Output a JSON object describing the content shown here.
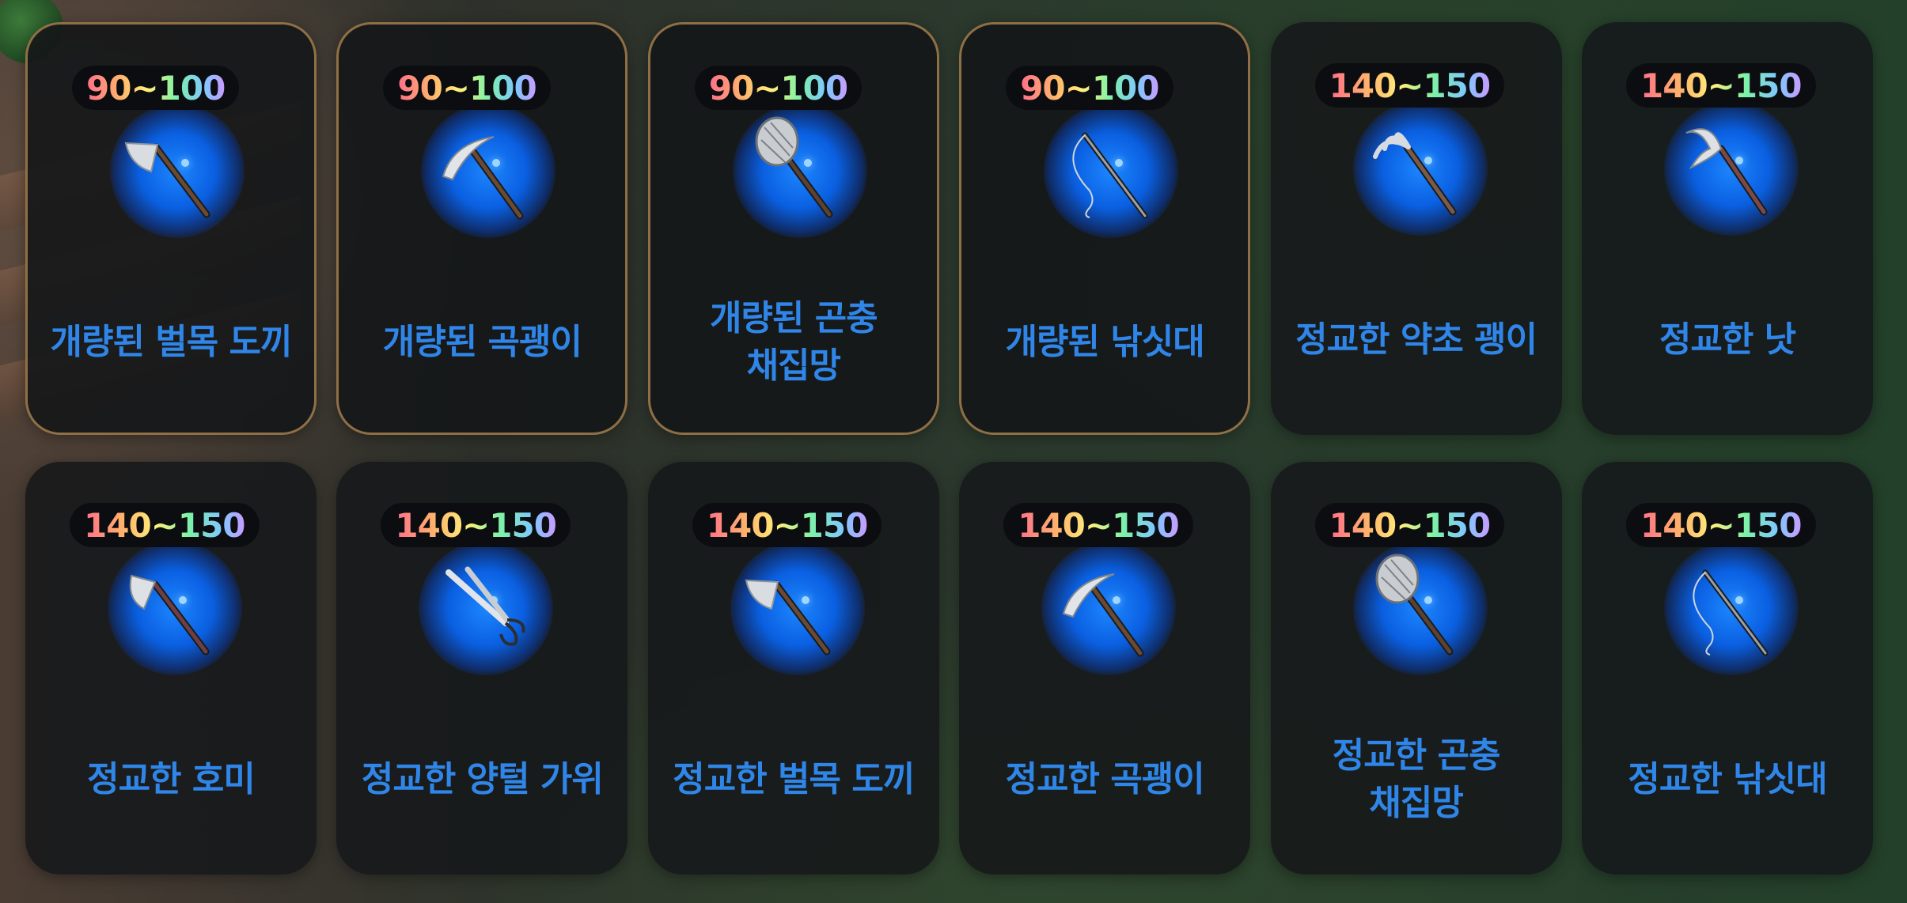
{
  "items": [
    {
      "level": "90~100",
      "name": "개량된 벌목 도끼",
      "tool_icon": "axe-icon",
      "tier": "improved"
    },
    {
      "level": "90~100",
      "name": "개량된 곡괭이",
      "tool_icon": "pickaxe-icon",
      "tier": "improved"
    },
    {
      "level": "90~100",
      "name": "개량된 곤충\n채집망",
      "tool_icon": "bug-net-icon",
      "tier": "improved"
    },
    {
      "level": "90~100",
      "name": "개량된 낚싯대",
      "tool_icon": "fishing-rod-icon",
      "tier": "improved"
    },
    {
      "level": "140~150",
      "name": "정교한 약초 괭이",
      "tool_icon": "herb-rake-icon",
      "tier": "elaborate"
    },
    {
      "level": "140~150",
      "name": "정교한 낫",
      "tool_icon": "sickle-icon",
      "tier": "elaborate"
    },
    {
      "level": "140~150",
      "name": "정교한 호미",
      "tool_icon": "hoe-icon",
      "tier": "elaborate"
    },
    {
      "level": "140~150",
      "name": "정교한 양털 가위",
      "tool_icon": "shears-icon",
      "tier": "elaborate"
    },
    {
      "level": "140~150",
      "name": "정교한 벌목 도끼",
      "tool_icon": "axe-icon",
      "tier": "elaborate"
    },
    {
      "level": "140~150",
      "name": "정교한 곡괭이",
      "tool_icon": "pickaxe-icon",
      "tier": "elaborate"
    },
    {
      "level": "140~150",
      "name": "정교한 곤충\n채집망",
      "tool_icon": "bug-net-icon",
      "tier": "elaborate"
    },
    {
      "level": "140~150",
      "name": "정교한 낚싯대",
      "tool_icon": "fishing-rod-icon",
      "tier": "elaborate"
    }
  ],
  "colors": {
    "name_text": "#2f86e8",
    "improved_border": "#8f6f45",
    "glow": "#1d86ff",
    "card_bg": "#16181a"
  }
}
